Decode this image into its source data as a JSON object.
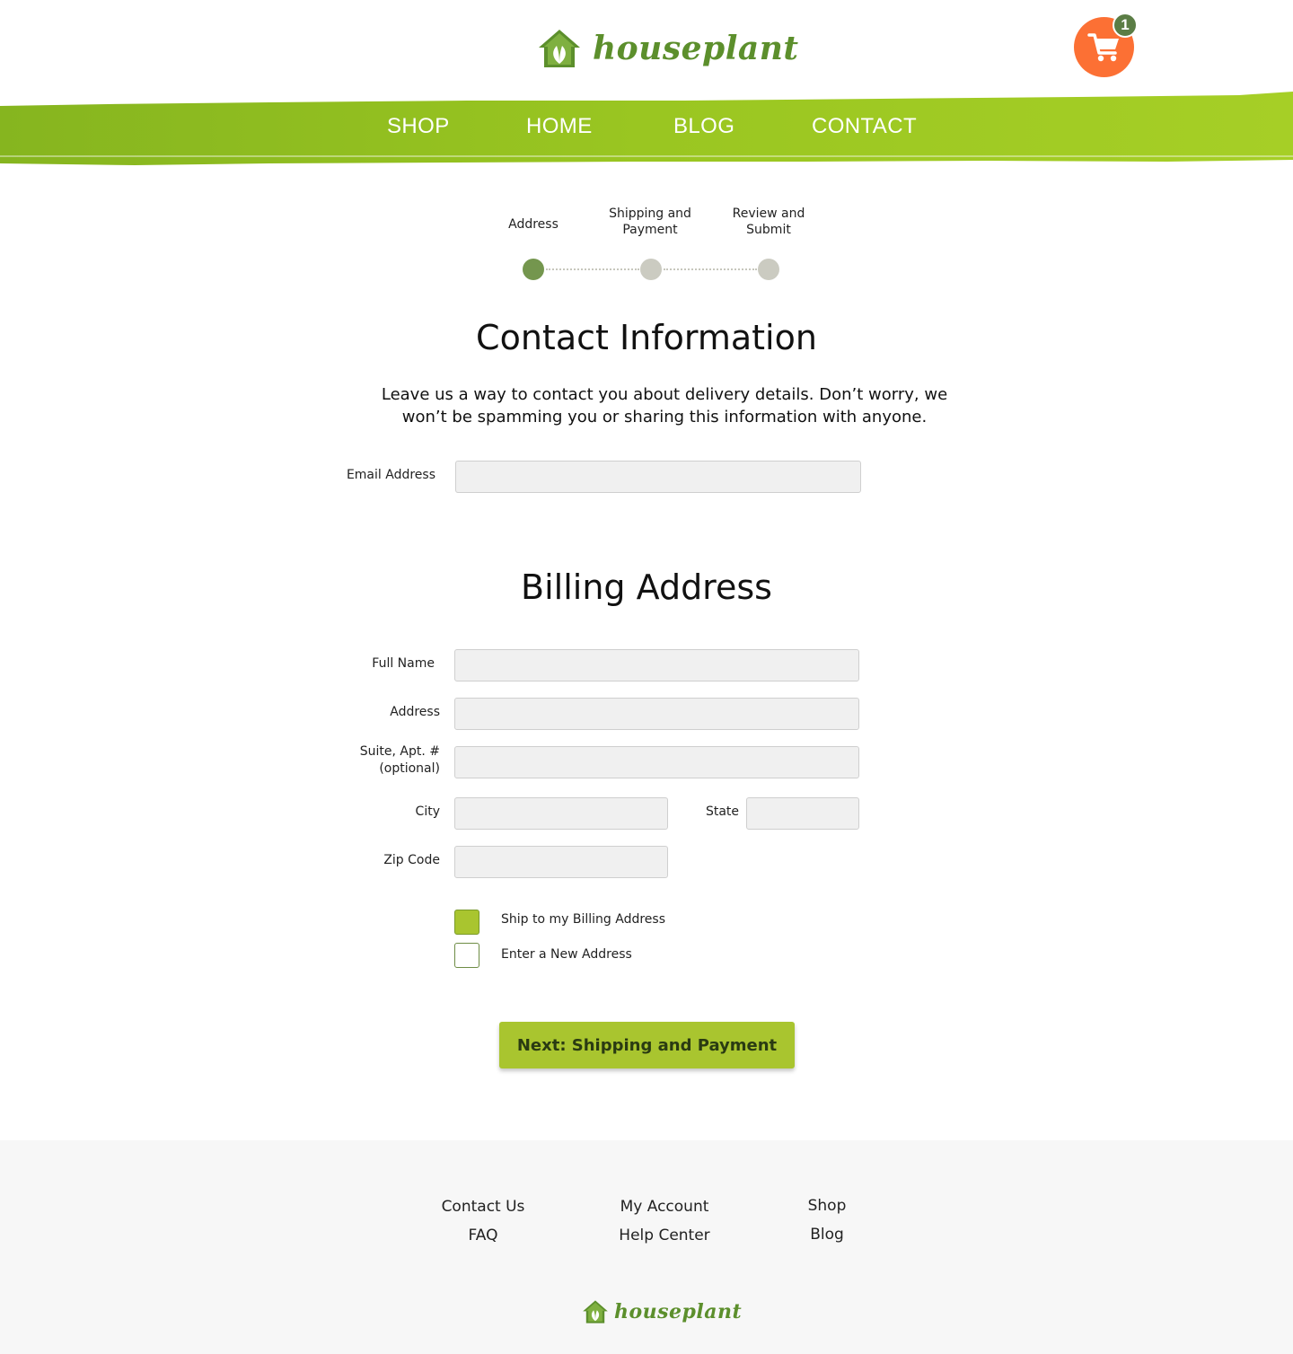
{
  "brand": {
    "name": "houseplant",
    "accent_green": "#a9c52f",
    "logo_green": "#5c8f2c",
    "cart_orange": "#fc7034"
  },
  "header": {
    "cart_icon": "shopping-cart-icon",
    "cart_count": "1"
  },
  "nav": {
    "items": [
      {
        "label": "SHOP"
      },
      {
        "label": "HOME"
      },
      {
        "label": "BLOG"
      },
      {
        "label": "CONTACT"
      }
    ]
  },
  "stepper": {
    "steps": [
      {
        "label_line1": "Address",
        "label_line2": "",
        "state": "active",
        "color": "#74964e"
      },
      {
        "label_line1": "Shipping and",
        "label_line2": "Payment",
        "state": "inactive",
        "color": "#cbcbc1"
      },
      {
        "label_line1": "Review and",
        "label_line2": "Submit",
        "state": "inactive",
        "color": "#cbcbc1"
      }
    ]
  },
  "contact": {
    "title": "Contact Information",
    "intro_line1": "Leave us a way to contact you about delivery details. Don’t worry, we",
    "intro_line2": "won’t be spamming you or sharing this information with anyone.",
    "email_label": "Email Address",
    "email_value": ""
  },
  "billing": {
    "title": "Billing Address",
    "full_name_label": "Full Name",
    "address_label": "Address",
    "suite_label_line1": "Suite, Apt. #",
    "suite_label_line2": "(optional)",
    "city_label": "City",
    "state_label": "State",
    "zip_label": "Zip Code",
    "options": [
      {
        "label": "Ship to my Billing Address",
        "checked": true
      },
      {
        "label": "Enter a New Address",
        "checked": false
      }
    ],
    "next_button": "Next: Shipping and Payment"
  },
  "footer": {
    "columns": [
      [
        "Contact Us",
        "FAQ"
      ],
      [
        "My Account",
        "Help Center"
      ],
      [
        "Shop",
        "Blog"
      ]
    ]
  }
}
